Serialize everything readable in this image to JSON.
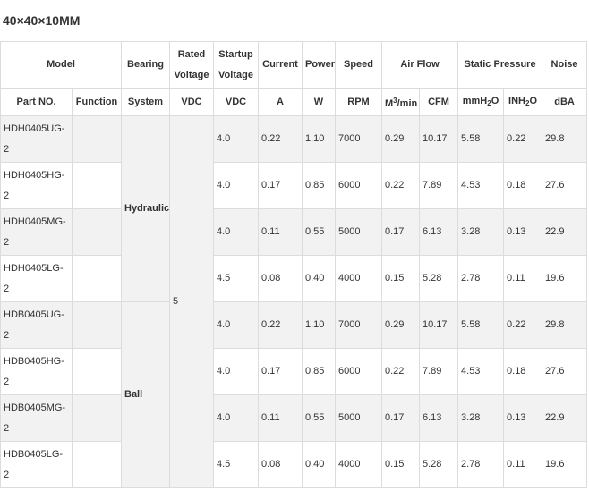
{
  "title": "40×40×10MM",
  "header_top": {
    "model": "Model",
    "bearing": "Bearing",
    "rated_voltage": [
      "Rated",
      "Voltage"
    ],
    "startup_voltage": [
      "Startup",
      "Voltage"
    ],
    "current": "Current",
    "power": "Power",
    "speed": "Speed",
    "air_flow": "Air Flow",
    "static_pressure": "Static Pressure",
    "noise": "Noise"
  },
  "header_sub": {
    "part_no": "Part NO.",
    "function": "Function",
    "system": "System",
    "vdc_rated": "VDC",
    "vdc_startup": "VDC",
    "amp": "A",
    "watt": "W",
    "rpm": "RPM",
    "m3min_base": "M",
    "m3min_exp": "3",
    "m3min_tail": "/min",
    "cfm": "CFM",
    "mmh2o_base": "mmH",
    "mmh2o_sub": "2",
    "mmh2o_tail": "O",
    "inh2o_base": "INH",
    "inh2o_sub": "2",
    "inh2o_tail": "O",
    "dba": "dBA"
  },
  "groups": {
    "hydraulic": "Hydraulic",
    "ball": "Ball",
    "rated_voltage": "5"
  },
  "rows": [
    {
      "part": [
        "HDH0405UG-",
        "2"
      ],
      "startup": "4.0",
      "current": "0.22",
      "power": "1.10",
      "rpm": "7000",
      "m3min": "0.29",
      "cfm": "10.17",
      "mmh2o": "5.58",
      "inh2o": "0.22",
      "dba": "29.8"
    },
    {
      "part": [
        "HDH0405HG-",
        "2"
      ],
      "startup": "4.0",
      "current": "0.17",
      "power": "0.85",
      "rpm": "6000",
      "m3min": "0.22",
      "cfm": "7.89",
      "mmh2o": "4.53",
      "inh2o": "0.18",
      "dba": "27.6"
    },
    {
      "part": [
        "HDH0405MG-",
        "2"
      ],
      "startup": "4.0",
      "current": "0.11",
      "power": "0.55",
      "rpm": "5000",
      "m3min": "0.17",
      "cfm": "6.13",
      "mmh2o": "3.28",
      "inh2o": "0.13",
      "dba": "22.9"
    },
    {
      "part": [
        "HDH0405LG-",
        "2"
      ],
      "startup": "4.5",
      "current": "0.08",
      "power": "0.40",
      "rpm": "4000",
      "m3min": "0.15",
      "cfm": "5.28",
      "mmh2o": "2.78",
      "inh2o": "0.11",
      "dba": "19.6"
    },
    {
      "part": [
        "HDB0405UG-",
        "2"
      ],
      "startup": "4.0",
      "current": "0.22",
      "power": "1.10",
      "rpm": "7000",
      "m3min": "0.29",
      "cfm": "10.17",
      "mmh2o": "5.58",
      "inh2o": "0.22",
      "dba": "29.8"
    },
    {
      "part": [
        "HDB0405HG-",
        "2"
      ],
      "startup": "4.0",
      "current": "0.17",
      "power": "0.85",
      "rpm": "6000",
      "m3min": "0.22",
      "cfm": "7.89",
      "mmh2o": "4.53",
      "inh2o": "0.18",
      "dba": "27.6"
    },
    {
      "part": [
        "HDB0405MG-",
        "2"
      ],
      "startup": "4.0",
      "current": "0.11",
      "power": "0.55",
      "rpm": "5000",
      "m3min": "0.17",
      "cfm": "6.13",
      "mmh2o": "3.28",
      "inh2o": "0.13",
      "dba": "22.9"
    },
    {
      "part": [
        "HDB0405LG-",
        "2"
      ],
      "startup": "4.5",
      "current": "0.08",
      "power": "0.40",
      "rpm": "4000",
      "m3min": "0.15",
      "cfm": "5.28",
      "mmh2o": "2.78",
      "inh2o": "0.11",
      "dba": "19.6"
    }
  ],
  "colors": {
    "shaded_row": "#f2f2f2",
    "border": "#dcdcdc",
    "text": "#333333"
  }
}
